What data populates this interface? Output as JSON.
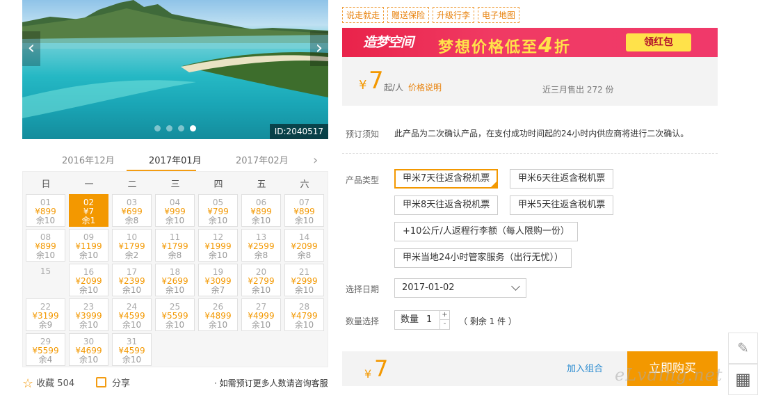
{
  "gallery": {
    "id_label": "ID:2040517",
    "prev": "‹",
    "next": "›"
  },
  "calendar": {
    "months": [
      "2016年12月",
      "2017年01月",
      "2017年02月"
    ],
    "next_icon": "›",
    "weekdays": [
      "日",
      "一",
      "二",
      "三",
      "四",
      "五",
      "六"
    ],
    "days": [
      {
        "d": "01",
        "p": "¥899",
        "r": "余10"
      },
      {
        "d": "02",
        "p": "¥7",
        "r": "余1",
        "selected": true
      },
      {
        "d": "03",
        "p": "¥699",
        "r": "余8"
      },
      {
        "d": "04",
        "p": "¥999",
        "r": "余10"
      },
      {
        "d": "05",
        "p": "¥799",
        "r": "余10"
      },
      {
        "d": "06",
        "p": "¥899",
        "r": "余10"
      },
      {
        "d": "07",
        "p": "¥899",
        "r": "余10"
      },
      {
        "d": "08",
        "p": "¥899",
        "r": "余10"
      },
      {
        "d": "09",
        "p": "¥1199",
        "r": "余10"
      },
      {
        "d": "10",
        "p": "¥1799",
        "r": "余2"
      },
      {
        "d": "11",
        "p": "¥1799",
        "r": "余8"
      },
      {
        "d": "12",
        "p": "¥1999",
        "r": "余10"
      },
      {
        "d": "13",
        "p": "¥2599",
        "r": "余8"
      },
      {
        "d": "14",
        "p": "¥2099",
        "r": "余8"
      },
      {
        "d": "15",
        "p": "",
        "r": ""
      },
      {
        "d": "16",
        "p": "¥2099",
        "r": "余10"
      },
      {
        "d": "17",
        "p": "¥2399",
        "r": "余10"
      },
      {
        "d": "18",
        "p": "¥2699",
        "r": "余10"
      },
      {
        "d": "19",
        "p": "¥3099",
        "r": "余7"
      },
      {
        "d": "20",
        "p": "¥2799",
        "r": "余10"
      },
      {
        "d": "21",
        "p": "¥2999",
        "r": "余10"
      },
      {
        "d": "22",
        "p": "¥3199",
        "r": "余9"
      },
      {
        "d": "23",
        "p": "¥3999",
        "r": "余10"
      },
      {
        "d": "24",
        "p": "¥4599",
        "r": "余10"
      },
      {
        "d": "25",
        "p": "¥5599",
        "r": "余10"
      },
      {
        "d": "26",
        "p": "¥4899",
        "r": "余10"
      },
      {
        "d": "27",
        "p": "¥4999",
        "r": "余10"
      },
      {
        "d": "28",
        "p": "¥4799",
        "r": "余10"
      },
      {
        "d": "29",
        "p": "¥5599",
        "r": "余4"
      },
      {
        "d": "30",
        "p": "¥4699",
        "r": "余10"
      },
      {
        "d": "31",
        "p": "¥4599",
        "r": "余10"
      }
    ]
  },
  "footer_left": {
    "fav_label": "收藏",
    "fav_count": "504",
    "share_label": "分享",
    "consult": "· 如需预订更多人数请咨询客服"
  },
  "tags": [
    "说走就走",
    "赠送保险",
    "升级行李",
    "电子地图"
  ],
  "banner": {
    "logo": "造梦空间",
    "slogan": "梦想价格低至",
    "big": "4",
    "suffix": "折",
    "button": "领红包"
  },
  "price": {
    "currency": "¥",
    "value": "7",
    "unit": "起/人",
    "link": "价格说明",
    "sold": "近三月售出 272 份"
  },
  "notice": {
    "label": "预订须知",
    "text": "此产品为二次确认产品，在支付成功时间起的24小时内供应商将进行二次确认。"
  },
  "product": {
    "label": "产品类型",
    "options": [
      "甲米7天往返含税机票",
      "甲米6天往返含税机票",
      "甲米8天往返含税机票",
      "甲米5天往返含税机票",
      "+10公斤/人返程行李额（每人限购一份）",
      "甲米当地24小时管家服务（出行无忧））"
    ]
  },
  "date": {
    "label": "选择日期",
    "value": "2017-01-02"
  },
  "quantity": {
    "label": "数量选择",
    "inner_label": "数量",
    "value": "1",
    "plus": "+",
    "minus": "-",
    "remain": "（ 剩余 1 件 ）"
  },
  "buy": {
    "currency": "¥",
    "value": "7",
    "combo": "加入组合",
    "button": "立即购买"
  },
  "side": {
    "edit_icon": "✎",
    "qr_icon": "▦"
  },
  "watermark": "eLvding.net",
  "colors": {
    "accent": "#f39800",
    "banner": "#e9234a",
    "link": "#2a8bd0"
  }
}
